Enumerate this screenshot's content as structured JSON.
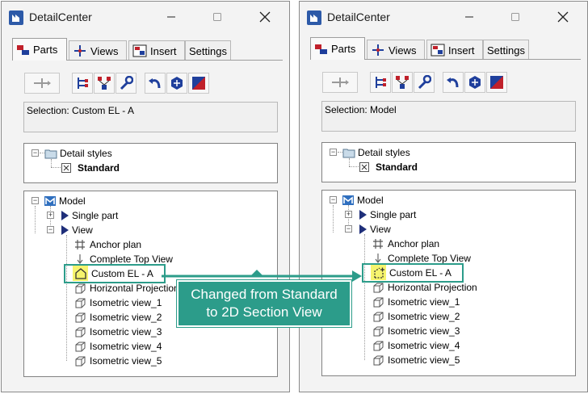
{
  "colors": {
    "accent": "#2c9c8a",
    "highlight_icon_bg": "#f6f46e",
    "model_icon": "#2f6fbf"
  },
  "left_window": {
    "title": "DetailCenter",
    "tabs": [
      {
        "label": "Parts",
        "icon": "parts-icon"
      },
      {
        "label": "Views",
        "icon": "views-icon"
      },
      {
        "label": "Insert",
        "icon": "insert-icon"
      },
      {
        "label": "Settings"
      }
    ],
    "selection_text": "Selection: Custom EL - A",
    "styles_tree": {
      "root": "Detail styles",
      "child": "Standard"
    },
    "model_tree": {
      "root": "Model",
      "items": [
        {
          "label": "Single part",
          "icon": "arrow-right-icon"
        },
        {
          "label": "View",
          "icon": "arrow-right-icon"
        },
        {
          "label": "Anchor plan",
          "icon": "grid-icon"
        },
        {
          "label": "Complete Top View",
          "icon": "down-arrow-icon"
        },
        {
          "label": "Custom EL - A",
          "icon": "house-outline-icon"
        },
        {
          "label": "Horizontal Projection",
          "icon": "cube-icon"
        },
        {
          "label": "Isometric view_1",
          "icon": "cube-icon"
        },
        {
          "label": "Isometric view_2",
          "icon": "cube-icon"
        },
        {
          "label": "Isometric view_3",
          "icon": "cube-icon"
        },
        {
          "label": "Isometric view_4",
          "icon": "cube-icon"
        },
        {
          "label": "Isometric view_5",
          "icon": "cube-icon"
        }
      ]
    }
  },
  "right_window": {
    "title": "DetailCenter",
    "tabs": [
      {
        "label": "Parts",
        "icon": "parts-icon"
      },
      {
        "label": "Views",
        "icon": "views-icon"
      },
      {
        "label": "Insert",
        "icon": "insert-icon"
      },
      {
        "label": "Settings"
      }
    ],
    "selection_text": "Selection: Model",
    "styles_tree": {
      "root": "Detail styles",
      "child": "Standard"
    },
    "model_tree": {
      "root": "Model",
      "items": [
        {
          "label": "Single part",
          "icon": "arrow-right-icon"
        },
        {
          "label": "View",
          "icon": "arrow-right-icon"
        },
        {
          "label": "Anchor plan",
          "icon": "grid-icon"
        },
        {
          "label": "Complete Top View",
          "icon": "down-arrow-icon"
        },
        {
          "label": "Custom EL - A",
          "icon": "section-view-icon"
        },
        {
          "label": "Horizontal Projection",
          "icon": "cube-icon"
        },
        {
          "label": "Isometric view_1",
          "icon": "cube-icon"
        },
        {
          "label": "Isometric view_2",
          "icon": "cube-icon"
        },
        {
          "label": "Isometric view_3",
          "icon": "cube-icon"
        },
        {
          "label": "Isometric view_4",
          "icon": "cube-icon"
        },
        {
          "label": "Isometric view_5",
          "icon": "cube-icon"
        }
      ]
    }
  },
  "callout": {
    "line1": "Changed from Standard",
    "line2": "to 2D Section View"
  }
}
